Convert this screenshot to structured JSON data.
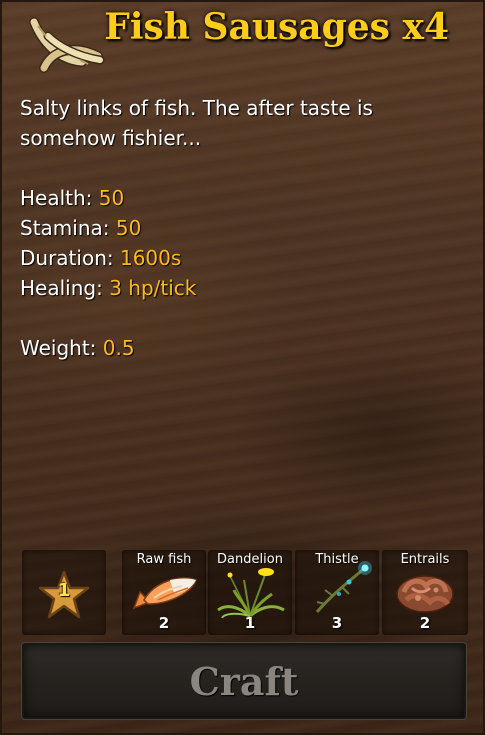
{
  "item": {
    "title": "Fish Sausages x4",
    "icon": "fish-sausages-icon",
    "description": "Salty links of fish. The after taste is somehow fishier..."
  },
  "stats": {
    "health_label": "Health:",
    "health_value": "50",
    "stamina_label": "Stamina:",
    "stamina_value": "50",
    "duration_label": "Duration:",
    "duration_value": "1600s",
    "healing_label": "Healing:",
    "healing_value": "3 hp/tick",
    "weight_label": "Weight:",
    "weight_value": "0.5"
  },
  "recipe": {
    "quality_level": "1",
    "ingredients": [
      {
        "name": "Raw fish",
        "count": "2",
        "icon": "raw-fish-icon"
      },
      {
        "name": "Dandelion",
        "count": "1",
        "icon": "dandelion-icon"
      },
      {
        "name": "Thistle",
        "count": "3",
        "icon": "thistle-icon"
      },
      {
        "name": "Entrails",
        "count": "2",
        "icon": "entrails-icon"
      }
    ]
  },
  "craft_button": {
    "label": "Craft"
  },
  "colors": {
    "title": "#ffcc1a",
    "stat_value": "#ffb81e",
    "text": "#ffffff",
    "craft_disabled_text": "#8a857e"
  }
}
